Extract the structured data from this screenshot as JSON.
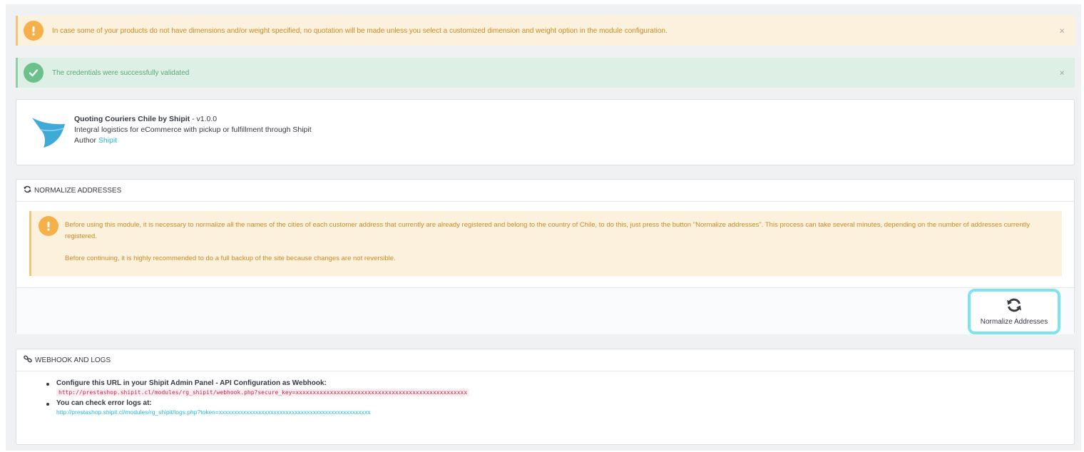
{
  "alerts": {
    "warning_text": "In case some of your products do not have dimensions and/or weight specified, no quotation will be made unless you select a customized dimension and weight option in the module configuration.",
    "success_text": "The credentials were successfully validated",
    "close_glyph": "×"
  },
  "module": {
    "name": "Quoting Couriers Chile by Shipit",
    "version": " - v1.0.0",
    "description": "Integral logistics for eCommerce with pickup or fulfillment through Shipit",
    "author_label": "Author ",
    "author_name": "Shipit"
  },
  "normalize": {
    "header": "NORMALIZE ADDRESSES",
    "paragraph1": "Before using this module, it is necessary to normalize all the names of the cities of each customer address that currently are already registered and belong to the country of Chile, to do this, just press the button \"Normalize addresses\". This process can take several minutes, depending on the number of addresses currently registered.",
    "paragraph2": "Before continuing, it is highly recommended to do a full backup of the site because changes are not reversible.",
    "button_label": "Normalize Addresses"
  },
  "webhook": {
    "header": "WEBHOOK AND LOGS",
    "item1_label": "Configure this URL in your Shipit Admin Panel - API Configuration as Webhook:",
    "webhook_url": "http://prestashop.shipit.cl/modules/rg_shipit/webhook.php?secure_key=xxxxxxxxxxxxxxxxxxxxxxxxxxxxxxxxxxxxxxxxxxxxxxxxxx",
    "item2_label": "You can check error logs at:",
    "logs_url": "http://prestashop.shipit.cl/modules/rg_shipit/logs.php?token=xxxxxxxxxxxxxxxxxxxxxxxxxxxxxxxxxxxxxxxxxxxxxxxxxx"
  },
  "icons": {
    "warning": "exclamation-icon",
    "success": "check-icon",
    "refresh": "refresh-icon",
    "link": "link-icon",
    "logo": "shipit-wing-logo"
  },
  "colors": {
    "warning_bg": "#fcf1dd",
    "warning_text": "#c98a29",
    "success_bg": "#def0e5",
    "success_text": "#5ba977",
    "link": "#25b9d7",
    "button_highlight": "#7de3ef",
    "logo": "#3fa9d8"
  }
}
